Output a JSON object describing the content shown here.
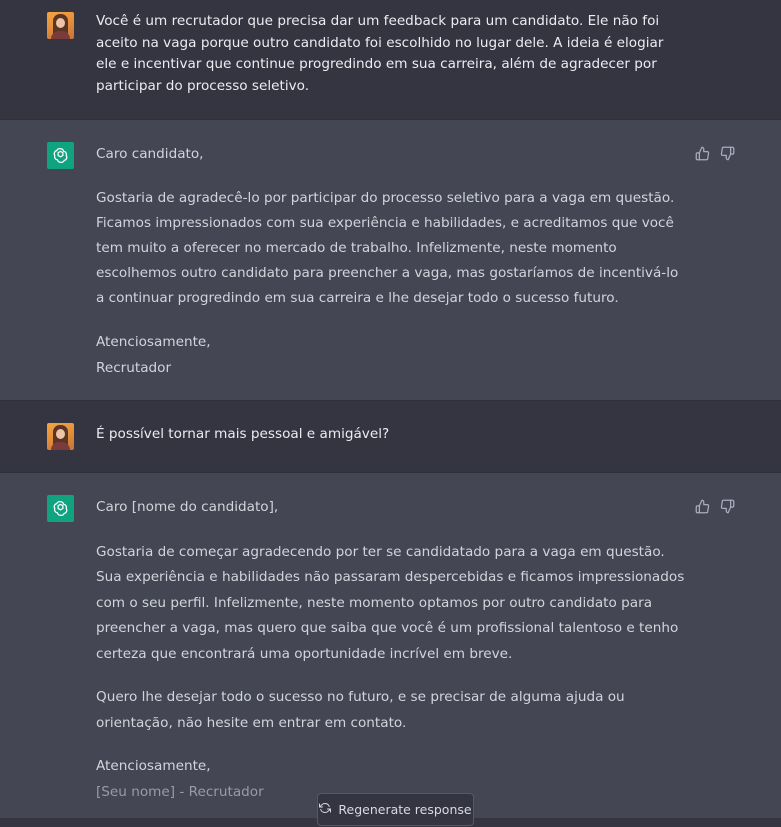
{
  "conversation": [
    {
      "role": "user",
      "text": "Você é um recrutador que precisa dar um feedback para um candidato. Ele não foi aceito na vaga porque outro candidato foi escolhido no lugar dele. A ideia é elogiar ele e incentivar que continue progredindo em sua carreira, além de agradecer por participar do processo seletivo."
    },
    {
      "role": "assistant",
      "greeting": "Caro candidato,",
      "body": "Gostaria de agradecê-lo por participar do processo seletivo para a vaga em questão. Ficamos impressionados com sua experiência e habilidades, e acreditamos que você tem muito a oferecer no mercado de trabalho. Infelizmente, neste momento escolhemos outro candidato para preencher a vaga, mas gostaríamos de incentivá-lo a continuar progredindo em sua carreira e lhe desejar todo o sucesso futuro.",
      "closing": "Atenciosamente,",
      "signature": "Recrutador"
    },
    {
      "role": "user",
      "text": "É possível tornar mais pessoal e amigável?"
    },
    {
      "role": "assistant",
      "greeting": "Caro [nome do candidato],",
      "body": "Gostaria de começar agradecendo por ter se candidatado para a vaga em questão. Sua experiência e habilidades não passaram despercebidas e ficamos impressionados com o seu perfil. Infelizmente, neste momento optamos por outro candidato para preencher a vaga, mas quero que saiba que você é um profissional talentoso e tenho certeza que encontrará uma oportunidade incrível em breve.",
      "body2": "Quero lhe desejar todo o sucesso no futuro, e se precisar de alguma ajuda ou orientação, não hesite em entrar em contato.",
      "closing": "Atenciosamente,",
      "signature": "[Seu nome] - Recrutador"
    }
  ],
  "icons": {
    "user_avatar": "user-avatar",
    "assistant_avatar": "openai-logo-icon",
    "thumbs_up": "thumbs-up-icon",
    "thumbs_down": "thumbs-down-icon",
    "regenerate": "refresh-icon"
  },
  "regenerate_label": "Regenerate response",
  "colors": {
    "background": "#343541",
    "assistant_background": "#444654",
    "assistant_logo": "#10a37f"
  }
}
